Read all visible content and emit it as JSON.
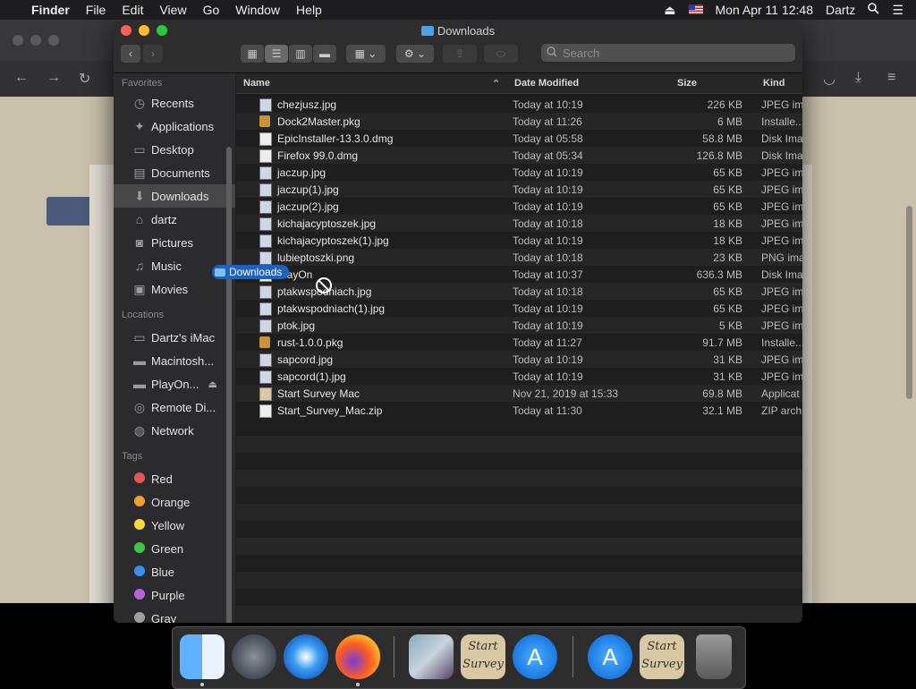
{
  "menubar": {
    "app_name": "Finder",
    "items": [
      "File",
      "Edit",
      "View",
      "Go",
      "Window",
      "Help"
    ],
    "clock": "Mon Apr 11  12:48",
    "user": "Dartz"
  },
  "window": {
    "title": "Downloads",
    "search_placeholder": "Search"
  },
  "sidebar": {
    "favorites_label": "Favorites",
    "favorites": [
      {
        "label": "Recents",
        "icon": "clock-icon"
      },
      {
        "label": "Applications",
        "icon": "applications-icon"
      },
      {
        "label": "Desktop",
        "icon": "desktop-icon"
      },
      {
        "label": "Documents",
        "icon": "document-icon"
      },
      {
        "label": "Downloads",
        "icon": "download-icon"
      },
      {
        "label": "dartz",
        "icon": "home-icon"
      },
      {
        "label": "Pictures",
        "icon": "camera-icon"
      },
      {
        "label": "Music",
        "icon": "music-icon"
      },
      {
        "label": "Movies",
        "icon": "film-icon"
      }
    ],
    "locations_label": "Locations",
    "locations": [
      {
        "label": "Dartz's iMac",
        "icon": "computer-icon"
      },
      {
        "label": "Macintosh...",
        "icon": "disk-icon"
      },
      {
        "label": "PlayOn...",
        "icon": "disk-icon"
      },
      {
        "label": "Remote Di...",
        "icon": "disc-icon"
      },
      {
        "label": "Network",
        "icon": "network-icon"
      }
    ],
    "tags_label": "Tags",
    "tags": [
      {
        "label": "Red",
        "color": "#e45454"
      },
      {
        "label": "Orange",
        "color": "#f0a030"
      },
      {
        "label": "Yellow",
        "color": "#f5d83c"
      },
      {
        "label": "Green",
        "color": "#3ec54a"
      },
      {
        "label": "Blue",
        "color": "#3a8ef0"
      },
      {
        "label": "Purple",
        "color": "#b464d6"
      },
      {
        "label": "Gray",
        "color": "#a0a0a0"
      }
    ]
  },
  "columns": {
    "name": "Name",
    "date": "Date Modified",
    "size": "Size",
    "kind": "Kind"
  },
  "files": [
    {
      "name": "chezjusz.jpg",
      "date": "Today at 10:19",
      "size": "226 KB",
      "kind": "JPEG im",
      "type": "image"
    },
    {
      "name": "Dock2Master.pkg",
      "date": "Today at 11:26",
      "size": "6 MB",
      "kind": "Installe...",
      "type": "package"
    },
    {
      "name": "EpicInstaller-13.3.0.dmg",
      "date": "Today at 05:58",
      "size": "58.8 MB",
      "kind": "Disk Ima",
      "type": "doc"
    },
    {
      "name": "Firefox 99.0.dmg",
      "date": "Today at 05:34",
      "size": "126.8 MB",
      "kind": "Disk Ima",
      "type": "doc"
    },
    {
      "name": "jaczup.jpg",
      "date": "Today at 10:19",
      "size": "65 KB",
      "kind": "JPEG im",
      "type": "image"
    },
    {
      "name": "jaczup(1).jpg",
      "date": "Today at 10:19",
      "size": "65 KB",
      "kind": "JPEG im",
      "type": "image"
    },
    {
      "name": "jaczup(2).jpg",
      "date": "Today at 10:19",
      "size": "65 KB",
      "kind": "JPEG im",
      "type": "image"
    },
    {
      "name": "kichajacyptoszek.jpg",
      "date": "Today at 10:18",
      "size": "18 KB",
      "kind": "JPEG im",
      "type": "image"
    },
    {
      "name": "kichajacyptoszek(1).jpg",
      "date": "Today at 10:19",
      "size": "18 KB",
      "kind": "JPEG im",
      "type": "image"
    },
    {
      "name": "lubieptoszki.png",
      "date": "Today at 10:18",
      "size": "23 KB",
      "kind": "PNG ima",
      "type": "image"
    },
    {
      "name": "PlayOn",
      "date": "Today at 10:37",
      "size": "636.3 MB",
      "kind": "Disk Ima",
      "type": "doc"
    },
    {
      "name": "ptakwspodniach.jpg",
      "date": "Today at 10:18",
      "size": "65 KB",
      "kind": "JPEG im",
      "type": "image"
    },
    {
      "name": "ptakwspodniach(1).jpg",
      "date": "Today at 10:19",
      "size": "65 KB",
      "kind": "JPEG im",
      "type": "image"
    },
    {
      "name": "ptok.jpg",
      "date": "Today at 10:19",
      "size": "5 KB",
      "kind": "JPEG im",
      "type": "image"
    },
    {
      "name": "rust-1.0.0.pkg",
      "date": "Today at 11:27",
      "size": "91.7 MB",
      "kind": "Installe...",
      "type": "package"
    },
    {
      "name": "sapcord.jpg",
      "date": "Today at 10:19",
      "size": "31 KB",
      "kind": "JPEG im",
      "type": "image"
    },
    {
      "name": "sapcord(1).jpg",
      "date": "Today at 10:19",
      "size": "31 KB",
      "kind": "JPEG im",
      "type": "image"
    },
    {
      "name": "Start Survey Mac",
      "date": "Nov 21, 2019 at 15:33",
      "size": "69.8 MB",
      "kind": "Applicat",
      "type": "app"
    },
    {
      "name": "Start_Survey_Mac.zip",
      "date": "Today at 11:30",
      "size": "32.1 MB",
      "kind": "ZIP arch",
      "type": "doc"
    }
  ],
  "drag_label": "Downloads",
  "dock": {
    "survey_label": "Start Survey"
  }
}
